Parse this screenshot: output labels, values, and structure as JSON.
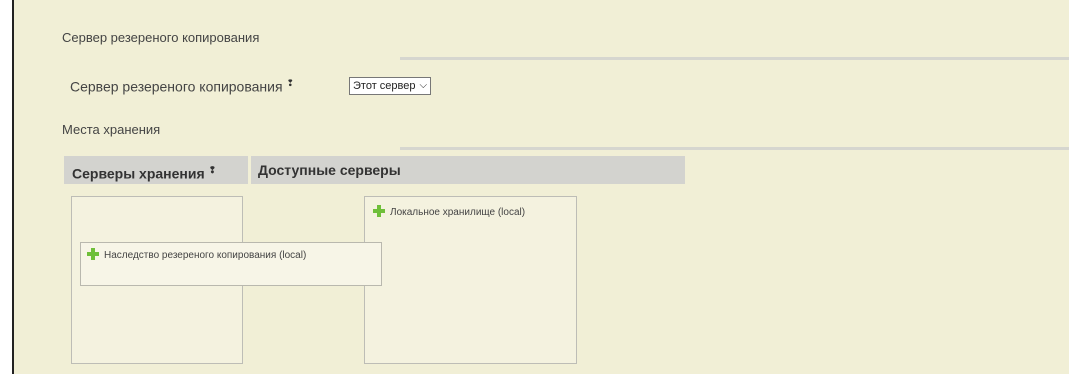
{
  "backup_section": {
    "title": "Сервер резереного копирования"
  },
  "backup_server": {
    "label": "Сервер резереного копирования",
    "info_mark": "❢",
    "select_value": "Этот сервер"
  },
  "storage_section": {
    "title": "Места хранения"
  },
  "storage_table": {
    "col_storage_servers": "Серверы хранения",
    "info_mark": "❢",
    "col_available_servers": "Доступные серверы"
  },
  "storage_items": [
    {
      "label": "Наследство резереного копирования (local)"
    }
  ],
  "available_items": [
    {
      "label": "Локальное хранилище (local)"
    }
  ],
  "icons": {
    "add": "plus-icon",
    "dropdown": "chevron-down-icon"
  },
  "colors": {
    "panel_bg": "#f1efd6",
    "header_bg": "#d3d3cf",
    "plus_green": "#6fbf3a"
  }
}
